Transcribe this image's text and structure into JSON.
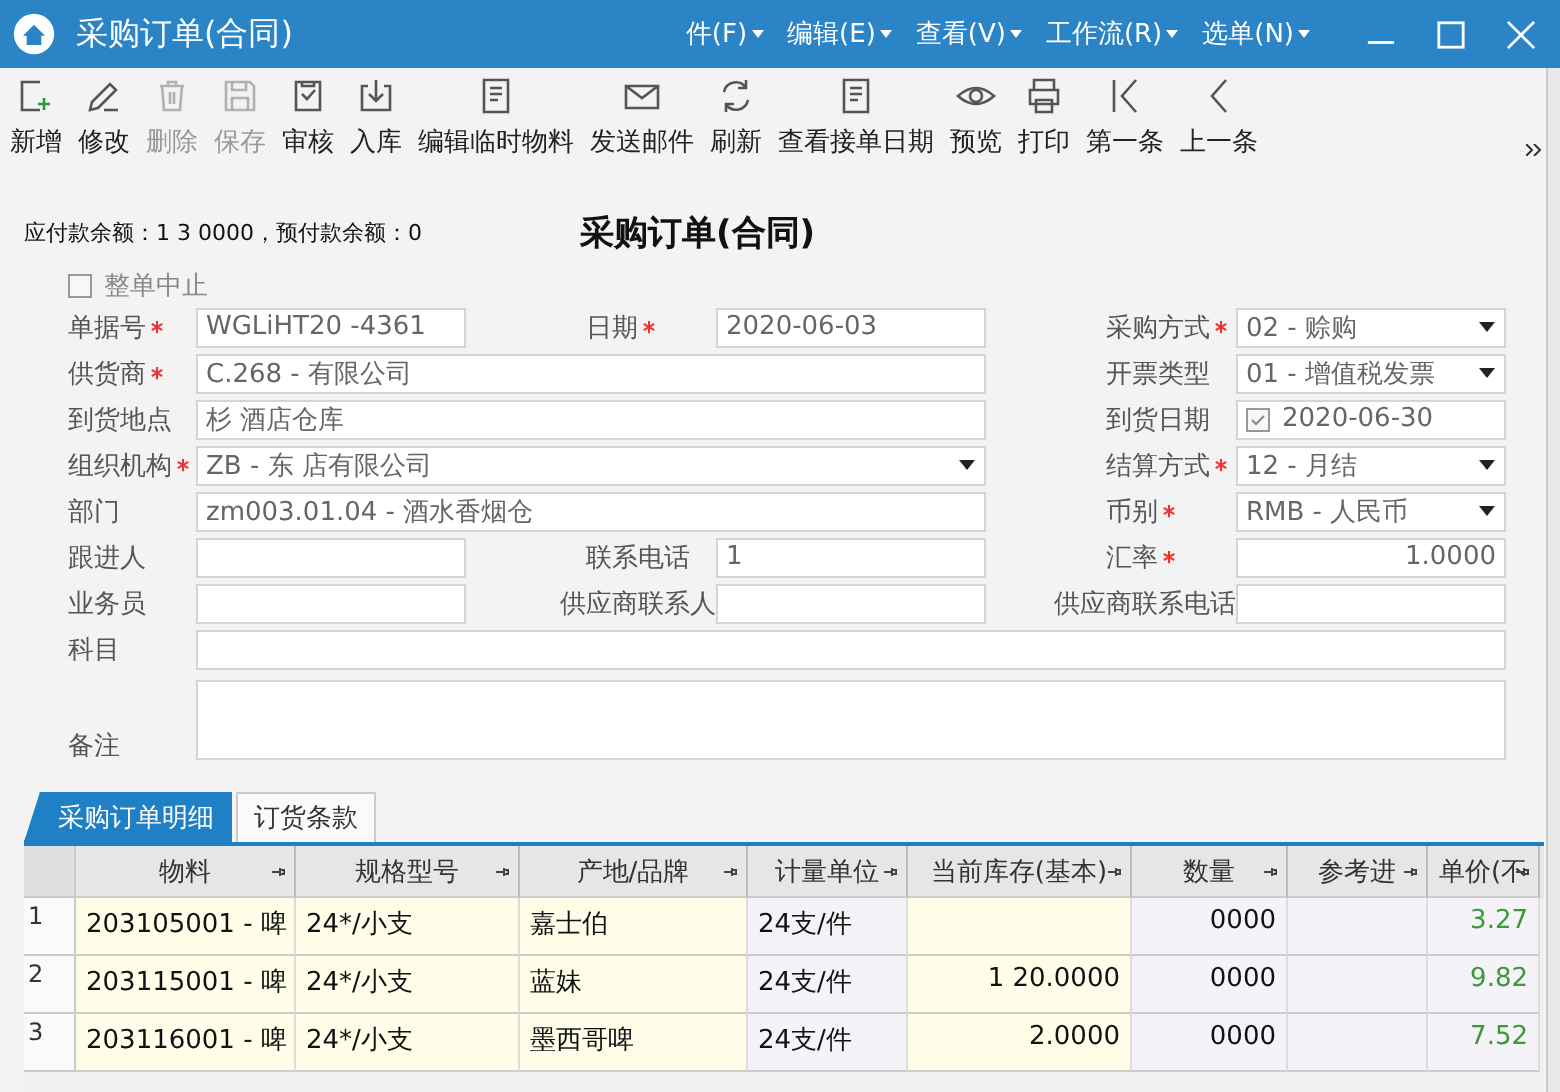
{
  "window": {
    "title": "采购订单(合同)",
    "menus": [
      {
        "label": "件(F)"
      },
      {
        "label": "编辑(E)"
      },
      {
        "label": "查看(V)"
      },
      {
        "label": "工作流(R)"
      },
      {
        "label": "选单(N)"
      }
    ]
  },
  "toolbar": [
    {
      "kind": "new",
      "label": "新增",
      "disabled": false
    },
    {
      "kind": "edit",
      "label": "修改",
      "disabled": false
    },
    {
      "kind": "delete",
      "label": "删除",
      "disabled": true
    },
    {
      "kind": "save",
      "label": "保存",
      "disabled": true
    },
    {
      "kind": "audit",
      "label": "审核",
      "disabled": false
    },
    {
      "kind": "stock-in",
      "label": "入库",
      "disabled": false
    },
    {
      "kind": "document",
      "label": "编辑临时物料",
      "disabled": false
    },
    {
      "kind": "mail",
      "label": "发送邮件",
      "disabled": false
    },
    {
      "kind": "refresh",
      "label": "刷新",
      "disabled": false
    },
    {
      "kind": "document",
      "label": "查看接单日期",
      "disabled": false
    },
    {
      "kind": "preview",
      "label": "预览",
      "disabled": false
    },
    {
      "kind": "print",
      "label": "打印",
      "disabled": false
    },
    {
      "kind": "first",
      "label": "第一条",
      "disabled": false
    },
    {
      "kind": "prev",
      "label": "上一条",
      "disabled": false
    }
  ],
  "balance": "应付款余额：1  3  0000，预付款余额：0",
  "form_title": "采购订单(合同)",
  "stop_checkbox": {
    "label": "整单中止",
    "checked": false
  },
  "form_rows": [
    {
      "left": {
        "label": "单据号",
        "required": true,
        "kind": "text",
        "value": "WGLiHT20  -4361"
      },
      "middle": {
        "label": "日期",
        "required": true,
        "kind": "text",
        "value": "2020-06-03"
      },
      "right": {
        "label": "采购方式",
        "required": true,
        "kind": "select",
        "value": "02 - 赊购"
      }
    },
    {
      "left": {
        "label": "供货商",
        "required": true,
        "kind": "text",
        "value": "C.268 -  有限公司"
      },
      "right": {
        "label": "开票类型",
        "required": false,
        "kind": "select",
        "value": "01 - 增值税发票"
      }
    },
    {
      "left": {
        "label": "到货地点",
        "required": false,
        "kind": "text",
        "value": "杉  酒店仓库"
      },
      "right": {
        "label": "到货日期",
        "required": false,
        "kind": "date-check",
        "checked": true,
        "value": "2020-06-30"
      }
    },
    {
      "left": {
        "label": "组织机构",
        "required": true,
        "kind": "select",
        "value": "ZB - 东  店有限公司"
      },
      "right": {
        "label": "结算方式",
        "required": true,
        "kind": "select",
        "value": "12 - 月结"
      }
    },
    {
      "left": {
        "label": "部门",
        "required": false,
        "kind": "text",
        "value": "zm003.01.04  - 酒水香烟仓"
      },
      "right": {
        "label": "币别",
        "required": true,
        "kind": "select",
        "value": "RMB - 人民币"
      }
    },
    {
      "left": {
        "label": "跟进人",
        "required": false,
        "kind": "text"
      },
      "middle": {
        "label": "联系电话",
        "required": false,
        "kind": "text",
        "value": "1"
      },
      "right": {
        "label": "汇率",
        "required": true,
        "kind": "number",
        "value": "1.0000"
      }
    },
    {
      "left": {
        "label": "业务员",
        "required": false,
        "kind": "text"
      },
      "middle": {
        "label": "供应商联系人",
        "required": false,
        "kind": "text"
      },
      "right": {
        "label": "供应商联系电话",
        "required": false,
        "kind": "text"
      }
    },
    {
      "left": {
        "label": "科目",
        "required": false,
        "kind": "text"
      }
    },
    {
      "left": {
        "label": "备注",
        "required": false,
        "kind": "textarea"
      }
    }
  ],
  "tabs": [
    {
      "label": "采购订单明细",
      "selected": true
    },
    {
      "label": "订货条款",
      "selected": false
    }
  ],
  "table": {
    "columns": [
      {
        "label": "物料",
        "editable": true
      },
      {
        "label": "规格型号",
        "editable": true
      },
      {
        "label": "产地/品牌",
        "editable": true
      },
      {
        "label": "计量单位",
        "editable": false
      },
      {
        "label": "当前库存(基本)",
        "editable": true
      },
      {
        "label": "数量",
        "editable": false
      },
      {
        "label": "参考进",
        "editable": false
      },
      {
        "label": "单价(不",
        "editable": false
      }
    ],
    "rows": [
      {
        "index": "1",
        "cells": [
          "203105001 - 啤",
          "24*/小支",
          "嘉士伯",
          "24支/件",
          null,
          "0000",
          null,
          "3.27"
        ]
      },
      {
        "index": "2",
        "cells": [
          "203115001 - 啤",
          "24*/小支",
          "蓝妹",
          "24支/件",
          "1  20.0000",
          "0000",
          null,
          "9.82"
        ]
      },
      {
        "index": "3",
        "cells": [
          "203116001 - 啤",
          "24*/小支",
          "墨西哥啤",
          "24支/件",
          "2.0000",
          "0000",
          null,
          "7.52"
        ]
      }
    ]
  }
}
